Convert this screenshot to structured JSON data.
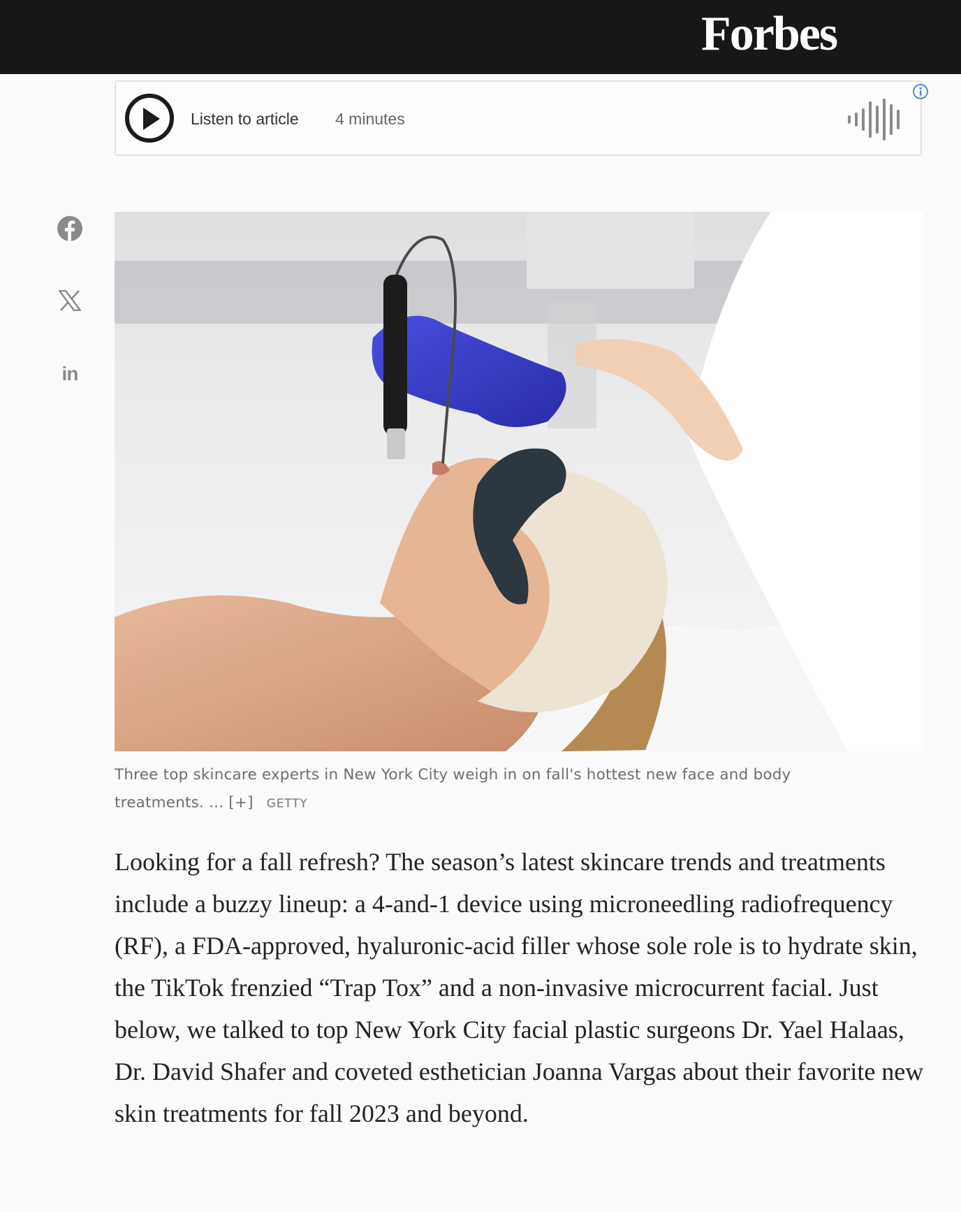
{
  "header": {
    "logo_text": "Forbes",
    "bg_color": "#181716"
  },
  "audio_player": {
    "play_icon": "play-circle-icon",
    "label": "Listen to article",
    "duration": "4 minutes",
    "waveform_icon": "audio-waveform-icon",
    "info_icon": "info-icon",
    "accent": "#3b7dd8"
  },
  "share": {
    "items": [
      {
        "icon": "facebook-icon",
        "label": "Facebook"
      },
      {
        "icon": "x-twitter-icon",
        "label": "X"
      },
      {
        "icon": "linkedin-icon",
        "label": "in"
      }
    ]
  },
  "hero_image": {
    "caption": "Three top skincare experts in New York City weigh in on fall's hottest new face and body treatments. ...",
    "expand_label": "[+]",
    "credit": "GETTY"
  },
  "article": {
    "paragraph_1": "Looking for a fall refresh? The season’s latest skincare trends and treatments include a buzzy lineup: a 4-and-1 device using microneedling radiofrequency (RF), a FDA-approved, hyaluronic-acid filler whose sole role is to hydrate skin, the TikTok frenzied “Trap Tox” and a non-invasive microcurrent facial. Just below, we talked to top New York City facial plastic surgeons Dr. Yael Halaas, Dr. David Shafer and coveted esthetician Joanna Vargas about their favorite new skin treatments for fall 2023 and beyond."
  }
}
